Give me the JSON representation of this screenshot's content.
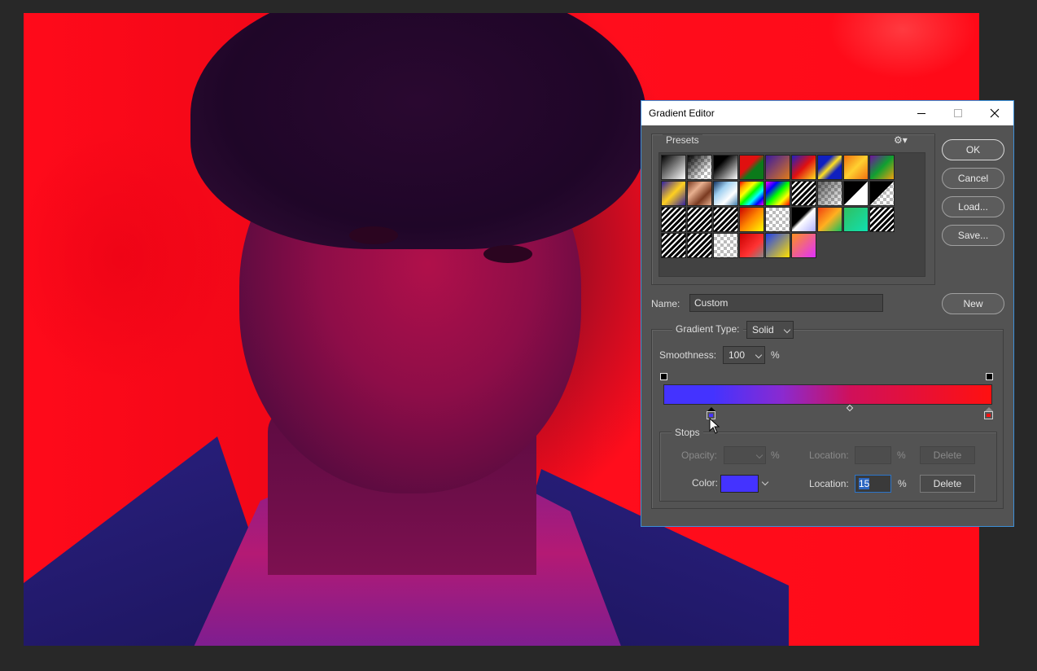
{
  "dialog": {
    "title": "Gradient Editor",
    "presets": {
      "label": "Presets",
      "swatches": [
        {
          "name": "black-white",
          "bg": "linear-gradient(135deg,#000,#fff)"
        },
        {
          "name": "black-transparent",
          "bg": "checker-black"
        },
        {
          "name": "black-white-2",
          "bg": "linear-gradient(135deg,#000,#000 30%,#fff)"
        },
        {
          "name": "red-green",
          "bg": "linear-gradient(135deg,#e01010 40%,#0b7a1a 60%)"
        },
        {
          "name": "violet-orange",
          "bg": "linear-gradient(135deg,#3a1aa0,#e07a1a)"
        },
        {
          "name": "blue-red-yellow",
          "bg": "linear-gradient(135deg,#2020c0,#e01010,#ffe020)"
        },
        {
          "name": "blue-yellow-blue",
          "bg": "linear-gradient(135deg,#1020c0 30%,#ffe020 50%,#1020c0 70%)"
        },
        {
          "name": "orange-yellow-orange",
          "bg": "linear-gradient(135deg,#f07010,#ffd030,#f07010)"
        },
        {
          "name": "violet-green-orange",
          "bg": "linear-gradient(135deg,#7010a0,#10a030,#f0a010)"
        },
        {
          "name": "yellow-violet-orange-blue",
          "bg": "linear-gradient(135deg,#3020a0,#ffd020,#3020a0)"
        },
        {
          "name": "copper",
          "bg": "linear-gradient(135deg,#7a3a20,#e8b090,#7a3a20,#e8b090)"
        },
        {
          "name": "chrome",
          "bg": "linear-gradient(135deg,#103060,#a0d0f0,#fff,#4080b0)"
        },
        {
          "name": "spectrum",
          "bg": "linear-gradient(135deg,red,orange,yellow,lime,cyan,blue,magenta)"
        },
        {
          "name": "transparent-rainbow",
          "bg": "linear-gradient(135deg,#f0f,#00f,#0f0,#ff0,#f00)"
        },
        {
          "name": "transparent-stripes",
          "bg": "stripes"
        },
        {
          "name": "neutral-density",
          "bg": "checker-gray"
        },
        {
          "name": "foreground-transparent",
          "bg": "linear-gradient(135deg,#000 50%,#fff 50%)"
        },
        {
          "name": "black-checker",
          "bg": "checker-diag"
        },
        {
          "name": "stripes-1",
          "bg": "stripes"
        },
        {
          "name": "stripes-2",
          "bg": "stripes"
        },
        {
          "name": "stripes-3",
          "bg": "stripes"
        },
        {
          "name": "red-yellow",
          "bg": "linear-gradient(135deg,#c00,#f80,#ff0)"
        },
        {
          "name": "checker-white",
          "bg": "checker-white"
        },
        {
          "name": "black-white-stripes",
          "bg": "linear-gradient(135deg,#000 40%,#fff 50%,#b0b0ff)"
        },
        {
          "name": "orange-green",
          "bg": "linear-gradient(135deg,#f04010,#ffb020,#10c060)"
        },
        {
          "name": "green-teal",
          "bg": "linear-gradient(135deg,#30c060,#10e0b0)"
        },
        {
          "name": "black-stripes",
          "bg": "stripes"
        },
        {
          "name": "white-stripes",
          "bg": "stripes"
        },
        {
          "name": "stripes-4",
          "bg": "stripes"
        },
        {
          "name": "checker-light",
          "bg": "checker-white"
        },
        {
          "name": "red-transparent",
          "bg": "linear-gradient(135deg,#c00,#f33 60%,#888)"
        },
        {
          "name": "blue-yellow",
          "bg": "linear-gradient(135deg,#2040f0,#ffe000)"
        },
        {
          "name": "orange-magenta",
          "bg": "linear-gradient(135deg,#ff9020,#e030ff)"
        }
      ]
    },
    "buttons": {
      "ok": "OK",
      "cancel": "Cancel",
      "load": "Load...",
      "save": "Save...",
      "new": "New"
    },
    "name_label": "Name:",
    "name_value": "Custom",
    "gradient_type_label": "Gradient Type:",
    "gradient_type_value": "Solid",
    "smoothness_label": "Smoothness:",
    "smoothness_value": "100",
    "percent": "%",
    "gradient": {
      "start_color": "#4433ff",
      "end_color": "#ff1010",
      "stops": [
        {
          "position": 15,
          "color": "#4433ff",
          "selected": true
        },
        {
          "position": 100,
          "color": "#ff1010",
          "selected": false
        }
      ],
      "opacity_stops": [
        0,
        100
      ],
      "midpoint": 57
    },
    "stops": {
      "label": "Stops",
      "opacity_label": "Opacity:",
      "opacity_value": "",
      "location_label": "Location:",
      "location_opacity_value": "",
      "delete_label": "Delete",
      "color_label": "Color:",
      "color_value": "#4433ff",
      "location_color_value": "15"
    }
  }
}
